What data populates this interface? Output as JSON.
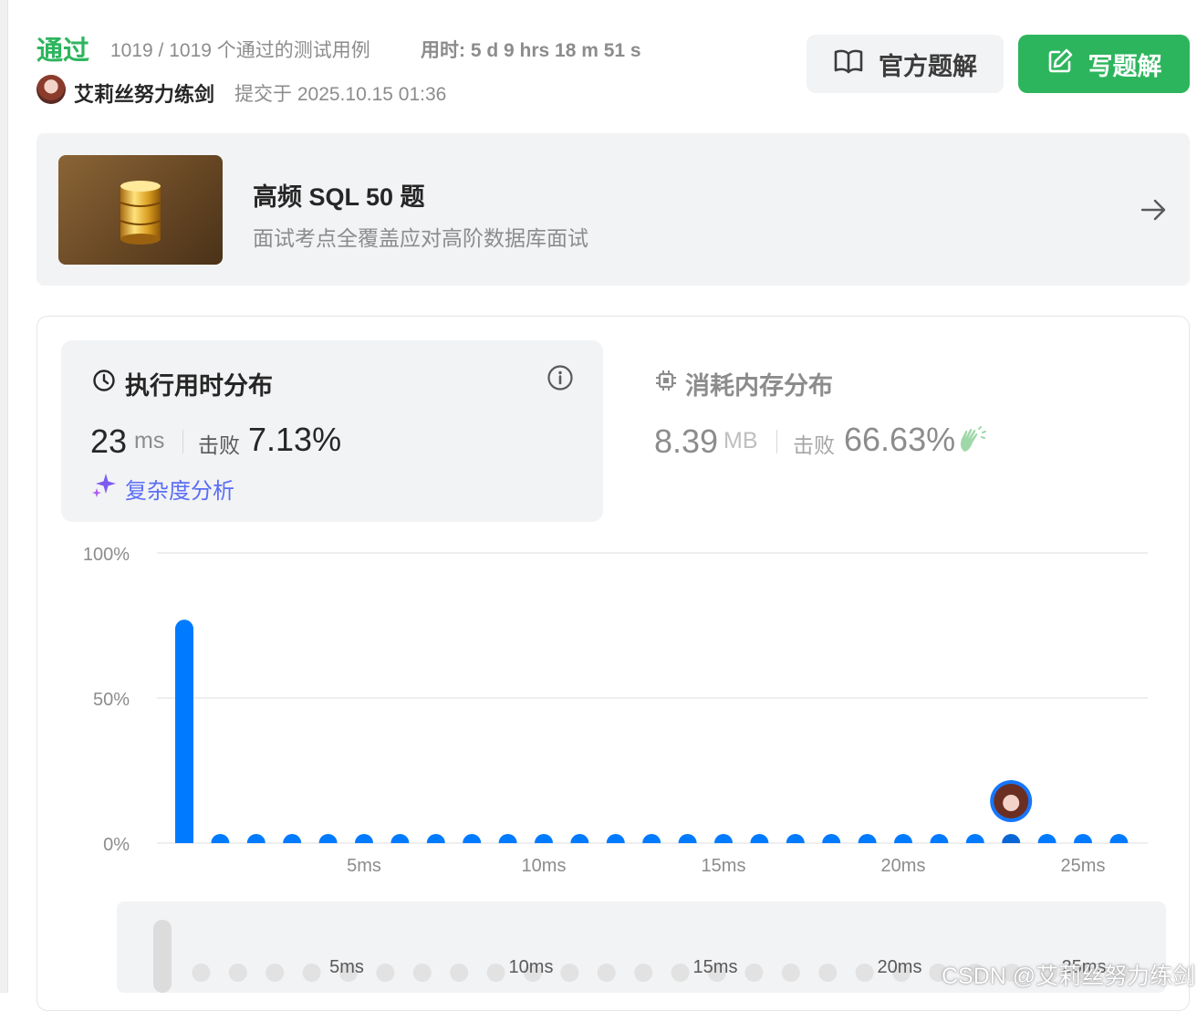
{
  "header": {
    "status": "通过",
    "testcases": "1019 / 1019 个通过的测试用例",
    "time_used": "用时: 5 d 9 hrs 18 m 51 s",
    "user_name": "艾莉丝努力练剑",
    "submitted": "提交于 2025.10.15 01:36",
    "official_solution_label": "官方题解",
    "write_solution_label": "写题解"
  },
  "study_plan": {
    "title": "高频 SQL 50 题",
    "subtitle": "面试考点全覆盖应对高阶数据库面试"
  },
  "runtime": {
    "title": "执行用时分布",
    "value": "23",
    "unit": "ms",
    "beat_label": "击败",
    "beat": "7.13%",
    "complexity_label": "复杂度分析"
  },
  "memory": {
    "title": "消耗内存分布",
    "value": "8.39",
    "unit": "MB",
    "beat_label": "击败",
    "beat": "66.63%"
  },
  "colors": {
    "accepted": "#2db55d",
    "bar": "#007aff",
    "accent_purple": "#5b6ef5",
    "mini_bar": "#dcdcdc"
  },
  "chart_data": {
    "type": "bar",
    "y_ticks": [
      "100%",
      "50%",
      "0%"
    ],
    "ylim": [
      0,
      100
    ],
    "x_ticks": [
      "5ms",
      "10ms",
      "15ms",
      "20ms",
      "25ms"
    ],
    "x": [
      0,
      1,
      2,
      3,
      4,
      5,
      6,
      7,
      8,
      9,
      10,
      11,
      12,
      13,
      14,
      15,
      16,
      17,
      18,
      19,
      20,
      21,
      22,
      23,
      24,
      25,
      26
    ],
    "values": [
      77,
      1,
      1,
      2,
      1,
      1,
      1,
      1,
      1,
      1,
      1,
      1,
      1,
      1,
      1,
      1,
      1,
      1,
      1,
      1,
      1,
      1,
      1,
      1,
      1,
      1,
      1
    ],
    "highlight_index": 23
  },
  "mini_chart": {
    "x_ticks": [
      "5ms",
      "10ms",
      "15ms",
      "20ms",
      "25ms"
    ]
  },
  "watermark": "CSDN @艾莉丝努力练剑"
}
